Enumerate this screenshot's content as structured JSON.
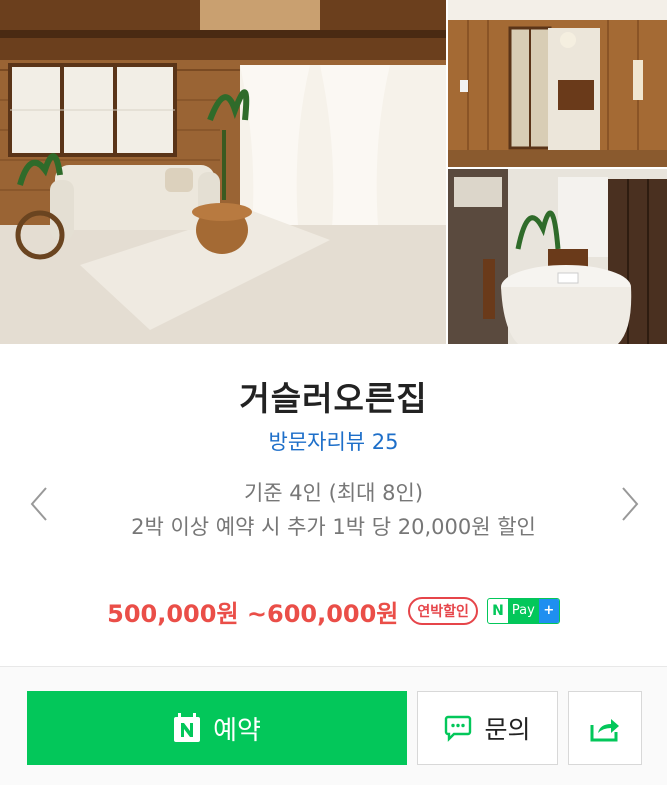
{
  "gallery": {
    "photos": [
      {
        "name": "living-room"
      },
      {
        "name": "hallway"
      },
      {
        "name": "dining-room"
      }
    ]
  },
  "listing": {
    "title": "거슬러오른집",
    "review_link": "방문자리뷰 25",
    "capacity": "기준 4인 (최대 8인)",
    "promo": "2박 이상 예약 시 추가 1박 당 20,000원 할인",
    "price": "500,000원 ~600,000원",
    "badge": "연박할인",
    "npay": {
      "n": "N",
      "pay": "Pay",
      "plus": "+"
    }
  },
  "actions": {
    "reserve_label": "예약",
    "inquiry_label": "문의",
    "share_icon": "share-icon"
  },
  "colors": {
    "accent_green": "#03c75a",
    "price_red": "#ea4e48",
    "link_blue": "#1e6fc9",
    "npay_blue": "#1f8ff0"
  }
}
